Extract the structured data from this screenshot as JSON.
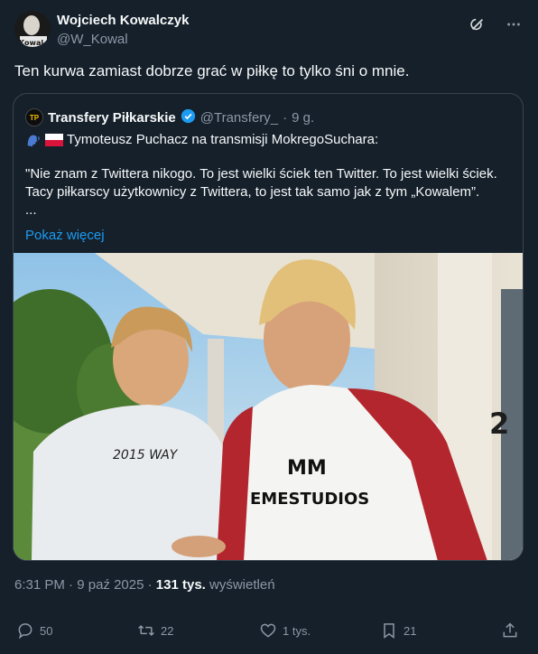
{
  "tweet": {
    "author_name": "Wojciech Kowalczyk",
    "author_handle": "@W_Kowal",
    "avatar_text": "Kowal",
    "text": "Ten kurwa zamiast dobrze grać w piłkę to tylko śni o mnie.",
    "time": "6:31 PM",
    "date": "9 paź 2025",
    "views_count": "131 tys.",
    "views_label": "wyświetleń"
  },
  "quote": {
    "avatar_text": "TP",
    "author_name": "Transfery Piłkarskie",
    "verified": true,
    "author_handle": "@Transfery_",
    "age": "9 g.",
    "line1": "Tymoteusz Puchacz na transmisji MokregoSuchara:",
    "para": "\"Nie znam z Twittera nikogo. To jest wielki ściek ten Twitter. To jest wielki ściek. Tacy piłkarscy użytkownicy z Twittera, to jest tak samo jak z tym „Kowalem”.",
    "ellipsis": "...",
    "show_more": "Pokaż więcej",
    "image": {
      "shirt_left_text": "2015 WAY",
      "shirt_right_logo": "MM",
      "shirt_right_text": "EMESTUDIOS",
      "house_number": "2"
    }
  },
  "actions": {
    "replies": "50",
    "reposts": "22",
    "likes": "1 tys.",
    "bookmarks": "21"
  },
  "icons": {
    "header": [
      "grok-icon",
      "more-icon"
    ],
    "actions": [
      "reply-icon",
      "repost-icon",
      "like-icon",
      "bookmark-icon",
      "share-icon"
    ]
  },
  "colors": {
    "background": "#15202b",
    "text": "#f7f9f9",
    "muted": "#8b98a5",
    "accent": "#1d9bf0",
    "border": "#38444d"
  }
}
